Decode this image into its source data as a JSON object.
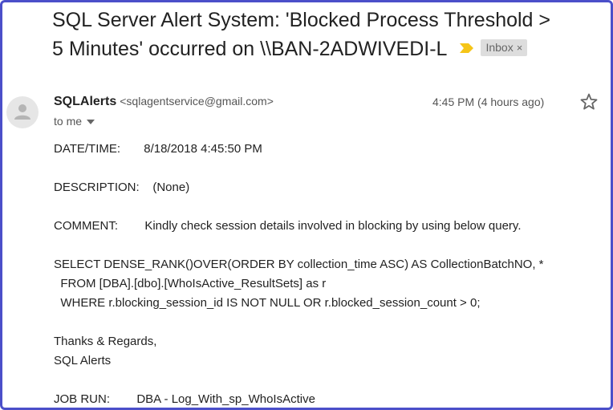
{
  "subject": {
    "line1": "SQL Server Alert System: 'Blocked Process Threshold >",
    "line2": "5 Minutes' occurred on \\\\BAN-2ADWIVEDI-L",
    "label": "Inbox",
    "label_close": "×"
  },
  "icons": {
    "importance": "importance-marker-icon",
    "avatar": "person-avatar-icon",
    "star": "star-icon",
    "caret": "caret-down-icon"
  },
  "colors": {
    "frame_border": "#4b4fc9",
    "importance_marker": "#f5c518",
    "label_bg": "#dddddd"
  },
  "sender": {
    "name": "SQLAlerts",
    "email": "<sqlagentservice@gmail.com>",
    "time": "4:45 PM (4 hours ago)",
    "recipient": "to me"
  },
  "body": {
    "datetime": "DATE/TIME:       8/18/2018 4:45:50 PM",
    "description": "DESCRIPTION:    (None)",
    "comment": "COMMENT:        Kindly check session details involved in blocking by using below query.",
    "query1": "SELECT DENSE_RANK()OVER(ORDER BY collection_time ASC) AS CollectionBatchNO, *",
    "query2": "  FROM [DBA].[dbo].[WhoIsActive_ResultSets] as r",
    "query3": "  WHERE r.blocking_session_id IS NOT NULL OR r.blocked_session_count > 0;",
    "thanks": "Thanks & Regards,",
    "signature": "SQL Alerts",
    "jobrun": "JOB RUN:        DBA - Log_With_sp_WhoIsActive"
  }
}
